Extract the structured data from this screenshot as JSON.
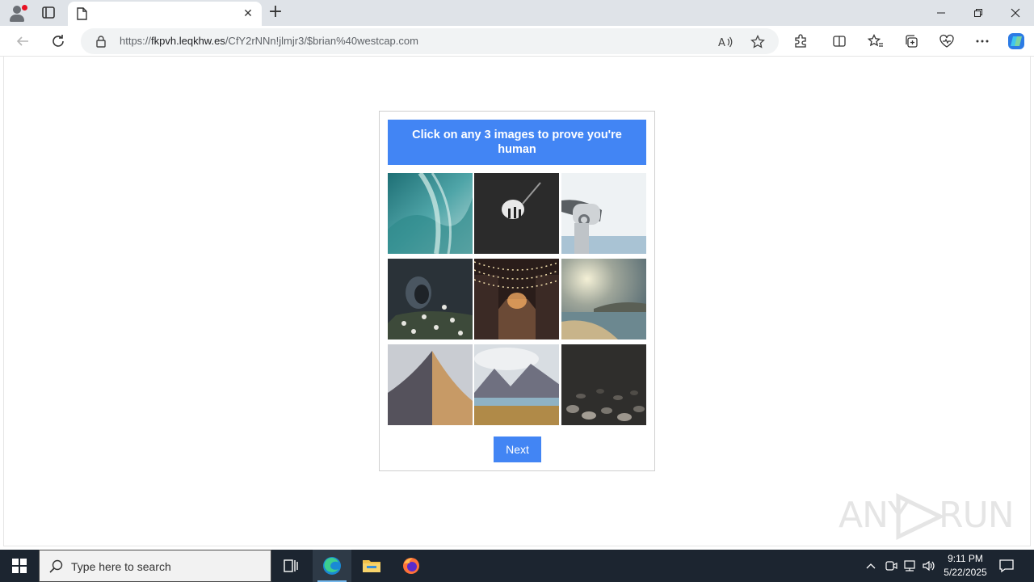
{
  "browser": {
    "tab_title": "",
    "url_prefix": "https://",
    "url_host": "fkpvh.leqkhw.es",
    "url_path": "/CfY2rNNn!jlmjr3/$brian%40westcap.com"
  },
  "captcha": {
    "instruction": "Click on any 3 images to prove you're human",
    "next_label": "Next",
    "header_color": "#4285f4",
    "tiles": [
      {
        "name": "ocean-wave"
      },
      {
        "name": "people-in-cave"
      },
      {
        "name": "coin-binoculars"
      },
      {
        "name": "person-in-flowers"
      },
      {
        "name": "street-string-lights"
      },
      {
        "name": "beach-sunset"
      },
      {
        "name": "sand-dune"
      },
      {
        "name": "mountain-lake"
      },
      {
        "name": "pebbles"
      }
    ]
  },
  "watermark": {
    "text_left": "ANY",
    "text_right": "RUN"
  },
  "taskbar": {
    "search_placeholder": "Type here to search",
    "time": "9:11 PM",
    "date": "5/22/2025"
  }
}
